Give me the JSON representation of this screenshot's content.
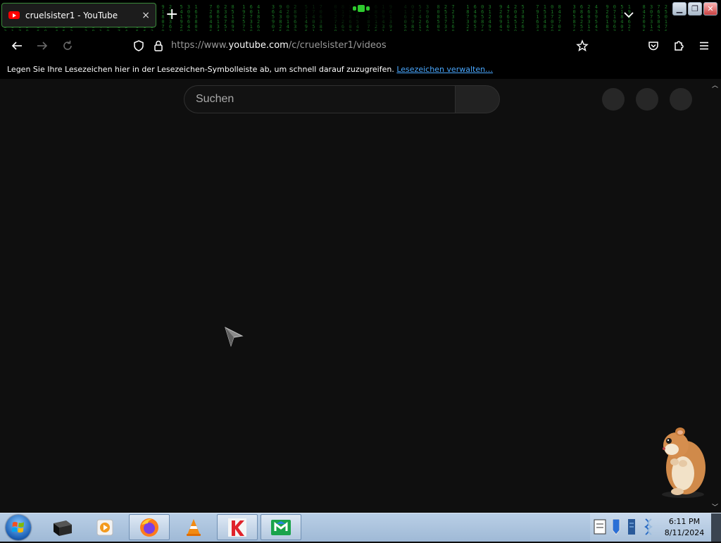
{
  "tab": {
    "title": "cruelsister1 - YouTube",
    "close_glyph": "×",
    "new_tab_glyph": "+"
  },
  "nav": {
    "url_prefix": "https://www.",
    "url_domain": "youtube.com",
    "url_path": "/c/cruelsister1/videos"
  },
  "bookmarks_bar": {
    "text": "Legen Sie Ihre Lesezeichen hier in der Lesezeichen-Symbolleiste ab, um schnell darauf zuzugreifen.",
    "link": "Lesezeichen verwalten…"
  },
  "youtube": {
    "search_placeholder": "Suchen"
  },
  "taskbar": {
    "time": "6:11 PM",
    "date": "8/11/2024",
    "apps": [
      "terminal-icon",
      "media-player-icon",
      "firefox-icon",
      "vlc-icon",
      "kaspersky-icon",
      "malwarebytes-icon"
    ]
  },
  "colors": {
    "page_bg": "#0f0f0f",
    "youtube_red": "#ff0000",
    "link": "#4aa8ff",
    "matrix_green": "#1f8a2a"
  }
}
